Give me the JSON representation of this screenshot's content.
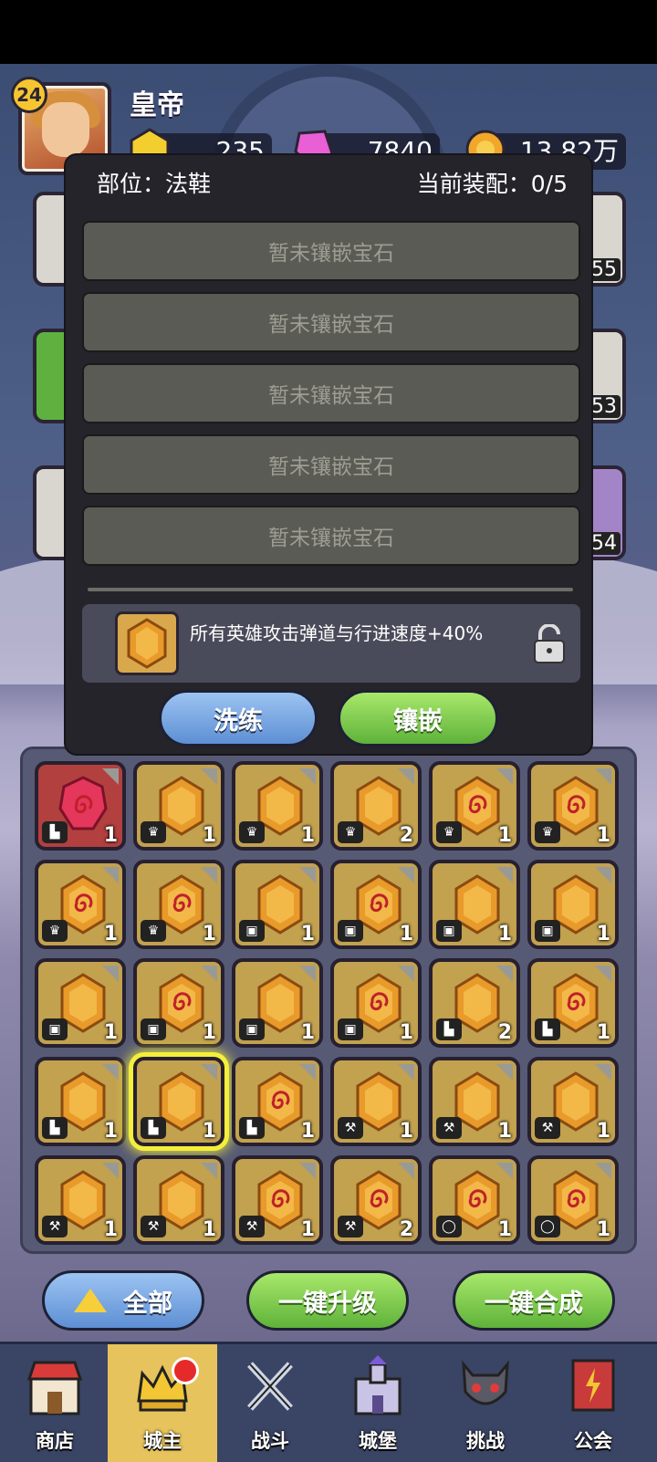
{
  "player": {
    "level": "24",
    "name": "皇帝"
  },
  "resources": [
    {
      "icon": "gold-gem-icon",
      "value": "235"
    },
    {
      "icon": "pink-crystal-icon",
      "value": "7840"
    },
    {
      "icon": "coin-icon",
      "value": "13.82万"
    }
  ],
  "side_slots": [
    {
      "level": "55"
    },
    {
      "level": "53"
    },
    {
      "level": "54"
    }
  ],
  "popup": {
    "position_label": "部位：法鞋",
    "equipped_label": "当前装配：0/5",
    "gem_slots": [
      "暂未镶嵌宝石",
      "暂未镶嵌宝石",
      "暂未镶嵌宝石",
      "暂未镶嵌宝石",
      "暂未镶嵌宝石"
    ],
    "effect_text": "所有英雄攻击弹道与行进速度+40%",
    "refine_button": "洗练",
    "inlay_button": "镶嵌"
  },
  "gems": [
    {
      "type": "boot",
      "count": "1",
      "variant": "red"
    },
    {
      "type": "crown",
      "count": "1",
      "variant": "plain"
    },
    {
      "type": "crown",
      "count": "1",
      "variant": "plain"
    },
    {
      "type": "crown",
      "count": "2",
      "variant": "plain"
    },
    {
      "type": "crown",
      "count": "1",
      "variant": "swirl"
    },
    {
      "type": "crown",
      "count": "1",
      "variant": "swirl"
    },
    {
      "type": "crown",
      "count": "1",
      "variant": "swirl"
    },
    {
      "type": "crown",
      "count": "1",
      "variant": "swirl"
    },
    {
      "type": "armor",
      "count": "1",
      "variant": "plain"
    },
    {
      "type": "armor",
      "count": "1",
      "variant": "swirl"
    },
    {
      "type": "armor",
      "count": "1",
      "variant": "plain"
    },
    {
      "type": "armor",
      "count": "1",
      "variant": "plain"
    },
    {
      "type": "armor",
      "count": "1",
      "variant": "plain"
    },
    {
      "type": "armor",
      "count": "1",
      "variant": "swirl"
    },
    {
      "type": "armor",
      "count": "1",
      "variant": "plain"
    },
    {
      "type": "armor",
      "count": "1",
      "variant": "swirl"
    },
    {
      "type": "boot",
      "count": "2",
      "variant": "plain"
    },
    {
      "type": "boot",
      "count": "1",
      "variant": "swirl"
    },
    {
      "type": "boot",
      "count": "1",
      "variant": "plain"
    },
    {
      "type": "boot",
      "count": "1",
      "variant": "plain"
    },
    {
      "type": "boot",
      "count": "1",
      "variant": "swirl"
    },
    {
      "type": "axe",
      "count": "1",
      "variant": "plain"
    },
    {
      "type": "axe",
      "count": "1",
      "variant": "plain"
    },
    {
      "type": "axe",
      "count": "1",
      "variant": "plain"
    },
    {
      "type": "axe",
      "count": "1",
      "variant": "plain"
    },
    {
      "type": "axe",
      "count": "1",
      "variant": "plain"
    },
    {
      "type": "axe",
      "count": "1",
      "variant": "swirl"
    },
    {
      "type": "axe",
      "count": "2",
      "variant": "swirl"
    },
    {
      "type": "ring",
      "count": "1",
      "variant": "swirl"
    },
    {
      "type": "ring",
      "count": "1",
      "variant": "swirl"
    }
  ],
  "selected_gem_index": 19,
  "actions": {
    "all": "全部",
    "upgrade_all": "一键升级",
    "merge_all": "一键合成"
  },
  "nav": [
    {
      "label": "商店",
      "icon": "shop-icon"
    },
    {
      "label": "城主",
      "icon": "lord-crown-icon"
    },
    {
      "label": "战斗",
      "icon": "crossed-swords-icon"
    },
    {
      "label": "城堡",
      "icon": "castle-icon"
    },
    {
      "label": "挑战",
      "icon": "demon-mask-icon"
    },
    {
      "label": "公会",
      "icon": "guild-banner-icon"
    }
  ],
  "nav_active_index": 1,
  "colors": {
    "gem_gold": "#c2a14f",
    "gem_red": "#b2403f",
    "highlight": "#f4ef3a"
  }
}
